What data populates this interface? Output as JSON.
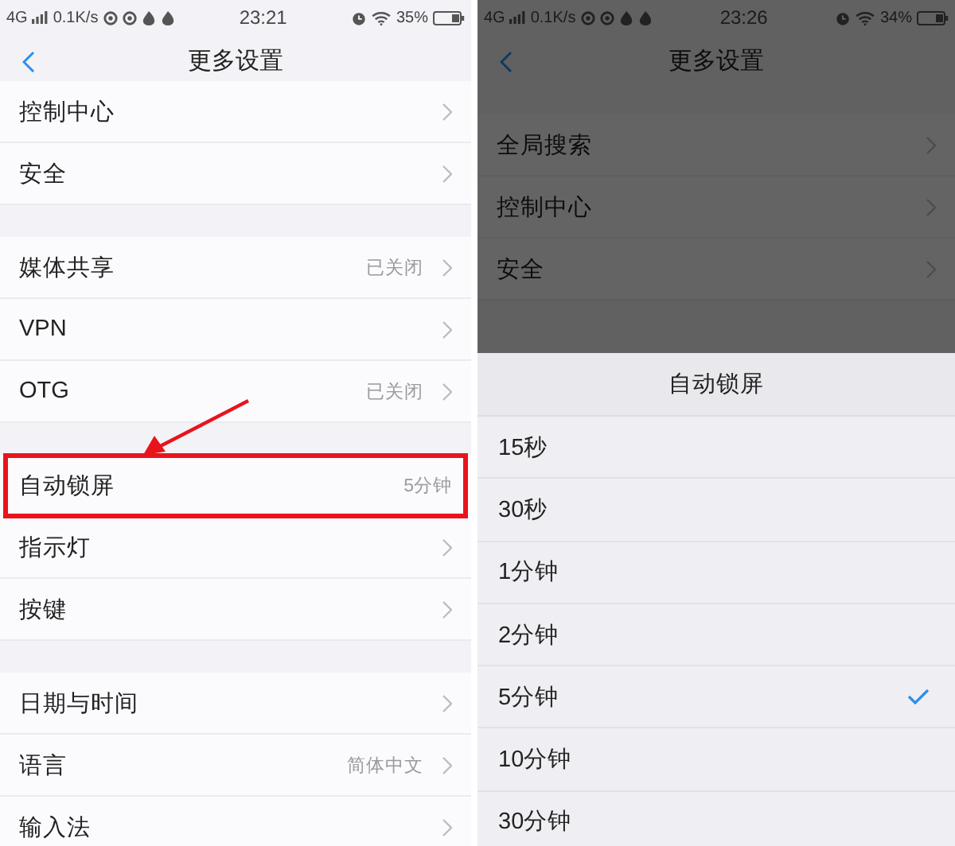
{
  "left_screen": {
    "status_bar": {
      "network": "4G",
      "speed": "0.1K/s",
      "time": "23:21",
      "battery": "35%"
    },
    "nav": {
      "title": "更多设置"
    },
    "groups": [
      {
        "rows": [
          {
            "label": "控制中心",
            "chevron": true,
            "highlighted": false
          },
          {
            "label": "安全",
            "chevron": true,
            "highlighted": false
          }
        ]
      },
      {
        "rows": [
          {
            "label": "媒体共享",
            "value": "已关闭",
            "chevron": true,
            "highlighted": false
          },
          {
            "label": "VPN",
            "chevron": true,
            "highlighted": false
          },
          {
            "label": "OTG",
            "value": "已关闭",
            "chevron": true,
            "highlighted": false
          }
        ]
      },
      {
        "rows": [
          {
            "label": "自动锁屏",
            "value": "5分钟",
            "chevron": false,
            "highlighted": true
          },
          {
            "label": "指示灯",
            "chevron": true,
            "highlighted": false
          },
          {
            "label": "按键",
            "chevron": true,
            "highlighted": false
          }
        ]
      },
      {
        "rows": [
          {
            "label": "日期与时间",
            "chevron": true,
            "highlighted": false
          },
          {
            "label": "语言",
            "value": "简体中文",
            "chevron": true,
            "highlighted": false
          },
          {
            "label": "输入法",
            "chevron": true,
            "highlighted": false
          }
        ]
      }
    ]
  },
  "right_screen": {
    "status_bar": {
      "network": "4G",
      "speed": "0.1K/s",
      "time": "23:26",
      "battery": "34%"
    },
    "nav": {
      "title": "更多设置"
    },
    "rows": [
      {
        "label": "全局搜索",
        "chevron": true
      },
      {
        "label": "控制中心",
        "chevron": true
      },
      {
        "label": "安全",
        "chevron": true
      }
    ],
    "dialog": {
      "title": "自动锁屏",
      "options": [
        {
          "label": "15秒",
          "selected": false
        },
        {
          "label": "30秒",
          "selected": false
        },
        {
          "label": "1分钟",
          "selected": false
        },
        {
          "label": "2分钟",
          "selected": false
        },
        {
          "label": "5分钟",
          "selected": true
        },
        {
          "label": "10分钟",
          "selected": false
        },
        {
          "label": "30分钟",
          "selected": false
        }
      ]
    }
  }
}
